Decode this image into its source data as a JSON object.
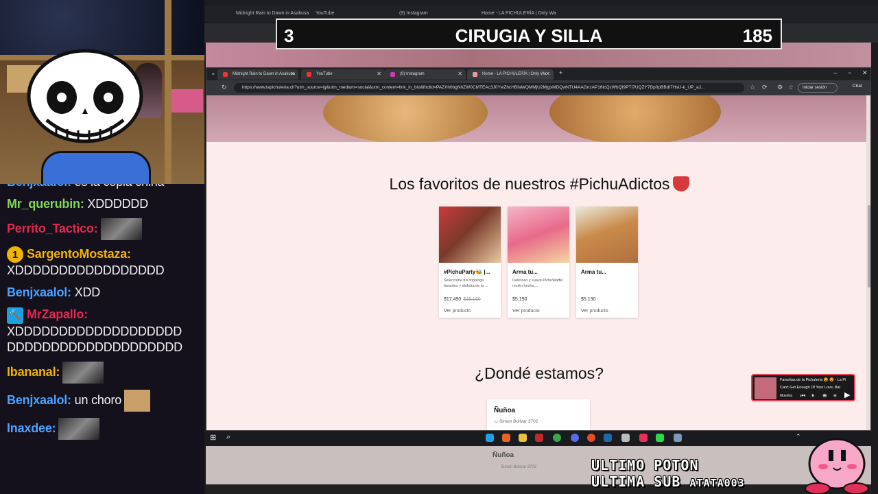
{
  "goal": {
    "number": "3",
    "title": "CIRUGIA Y SILLA",
    "count": "185"
  },
  "chat": [
    {
      "user": "Benjxaalol",
      "sep": ":",
      "text": " es la copia china",
      "color": "#4aa3ff",
      "emote": false
    },
    {
      "user": "Mr_querubin",
      "sep": ":",
      "text": " XDDDDDD",
      "color": "#7ed957",
      "emote": false
    },
    {
      "user": "Perrito_Tactico",
      "sep": ":",
      "text": "",
      "color": "#e0294e",
      "emote": true
    },
    {
      "user": "SargentoMostaza",
      "sep": ":",
      "text": "XDDDDDDDDDDDDDDDDD",
      "color": "#f2b400",
      "badge": "1",
      "break": true
    },
    {
      "user": "Benjxaalol",
      "sep": ":",
      "text": " XDD",
      "color": "#4aa3ff",
      "emote": false
    },
    {
      "user": "MrZapallo",
      "sep": ":",
      "text": "XDDDDDDDDDDDDDDDDDDD DDDDDDDDDDDDDDDDDDDD",
      "color": "#e0294e",
      "badge": "🔨",
      "break": true
    },
    {
      "user": "Ibananal",
      "sep": ":",
      "text": "",
      "color": "#f2b400",
      "emote": true
    },
    {
      "user": "Benjxaalol",
      "sep": ":",
      "text": " un choro",
      "color": "#4aa3ff",
      "emote": true,
      "cat": true
    },
    {
      "user": "Inaxdee",
      "sep": ":",
      "text": "",
      "color": "#4aa3ff",
      "emote": true
    }
  ],
  "browser": {
    "tabs": [
      {
        "label": "Midnight Rain to Dawn in Asakusa",
        "color": "#e33"
      },
      {
        "label": "YouTube",
        "color": "#e33"
      },
      {
        "label": "(9) Instagram",
        "color": "#d23ab0"
      },
      {
        "label": "Home - LA PICHULERÍA | Only Wa",
        "color": "#e89aa8"
      }
    ],
    "new_tab": "+",
    "url": "https://www.lapichuleria.cl/?utm_source=ig&utm_medium=social&utm_content=link_in_bio&fbclid=PAZXh0bgNhZW0CMTEAc3J0YwZhcHBfaWQMMjU2MjgxMDQwNTU4AAGnzAP16tcQzWbQI9PTI7UQZY7Dp0pBBdI7HsU-k_UP_aJ...",
    "signin": "Iniciar sesión",
    "chat_btn": "Chat"
  },
  "page": {
    "favorites_title": "Los favoritos de nuestros #PichuAdictos",
    "products": [
      {
        "name": "#PichuParty🐝 |...",
        "desc": "Selecciona tus toppings favoritos y disfruta de tu ...",
        "price": "$17.490",
        "old_price": "$19.160",
        "cta": "Ver producto",
        "img": "linear-gradient(135deg,#c93b3b,#7a3a2a 45%,#e8c9a0)"
      },
      {
        "name": "Arma tu...",
        "desc": "Delicioso y suave PichuWaffle recién hecho,...",
        "price": "$5.190",
        "old_price": "",
        "cta": "Ver producto",
        "img": "linear-gradient(160deg,#f3b6c8,#e86a8a 50%,#f5d6a0)"
      },
      {
        "name": "Arma tu...",
        "desc": "",
        "price": "$5.190",
        "old_price": "",
        "cta": "Ver producto",
        "img": "linear-gradient(160deg,#eaeadc,#c98a4a 45%,#b07040)"
      }
    ],
    "where_title": "¿Dondé estamos?",
    "location": {
      "name": "Ñuñoa",
      "address": "Simon Bolivar 3702"
    }
  },
  "miniplayer": {
    "title": "Favoritas de la Pichulería 😍 😍 - La Pi",
    "song": "Can't Get Enough Of Your Love, Bal",
    "action": "Muestra"
  },
  "overlay": {
    "line1": "ULTIMO POTON",
    "line2": "ULTIMA SUB",
    "tag": "ATATA003"
  },
  "mirror": {
    "name": "Ñuñoa",
    "address": "Simon Bolivar 3702"
  }
}
